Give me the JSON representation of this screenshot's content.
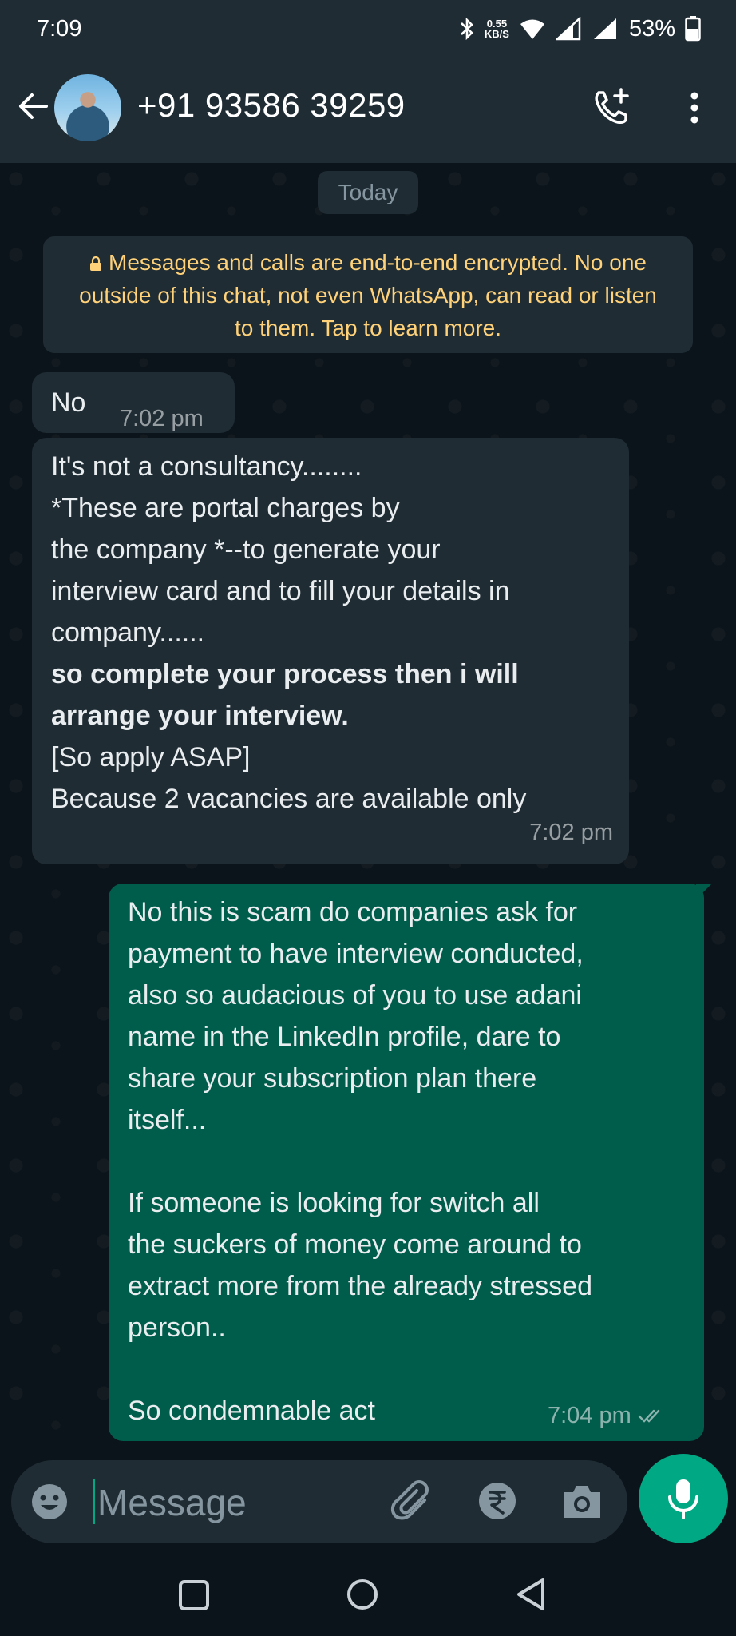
{
  "status_bar": {
    "time": "7:09",
    "net_speed_value": "0.55",
    "net_speed_unit": "KB/S",
    "battery": "53%"
  },
  "header": {
    "contact_name": "+91 93586 39259",
    "icons": [
      "back-arrow-icon",
      "avatar",
      "add-call-icon",
      "more-vert-icon"
    ]
  },
  "chat": {
    "date_chip": "Today",
    "encryption_notice": "Messages and calls are end-to-end encrypted. No one outside of this chat, not even WhatsApp, can read or listen to them. Tap to learn more.",
    "messages": [
      {
        "direction": "incoming",
        "lines": [
          "No"
        ],
        "time": "7:02 pm"
      },
      {
        "direction": "incoming",
        "lines": [
          "It's not a consultancy........",
          "*These are portal charges by",
          "the company *--to generate your",
          "interview card and to fill your details in",
          "company......",
          "so complete your process then i will",
          "arrange your interview.",
          "[So apply ASAP]",
          "Because 2 vacancies are available only"
        ],
        "time": "7:02 pm"
      },
      {
        "direction": "outgoing",
        "lines": [
          "No this is scam do companies ask for",
          "payment to have interview conducted,",
          "also so audacious of you to use adani",
          "name in the LinkedIn profile, dare to",
          "share your subscription plan there",
          "itself...",
          "",
          "If someone is looking for switch all",
          "the suckers of money come around to",
          "extract more from the already stressed",
          "person..",
          "",
          "So condemnable act"
        ],
        "time": "7:04 pm",
        "status": "read"
      }
    ]
  },
  "composer": {
    "placeholder": "Message",
    "icons": [
      "emoji-icon",
      "attach-icon",
      "rupee-icon",
      "camera-icon",
      "mic-icon"
    ]
  },
  "colors": {
    "background": "#0b141a",
    "bar": "#1f2c34",
    "outgoing_bubble": "#005c4b",
    "accent": "#00a884",
    "notice_text": "#ffd279"
  }
}
